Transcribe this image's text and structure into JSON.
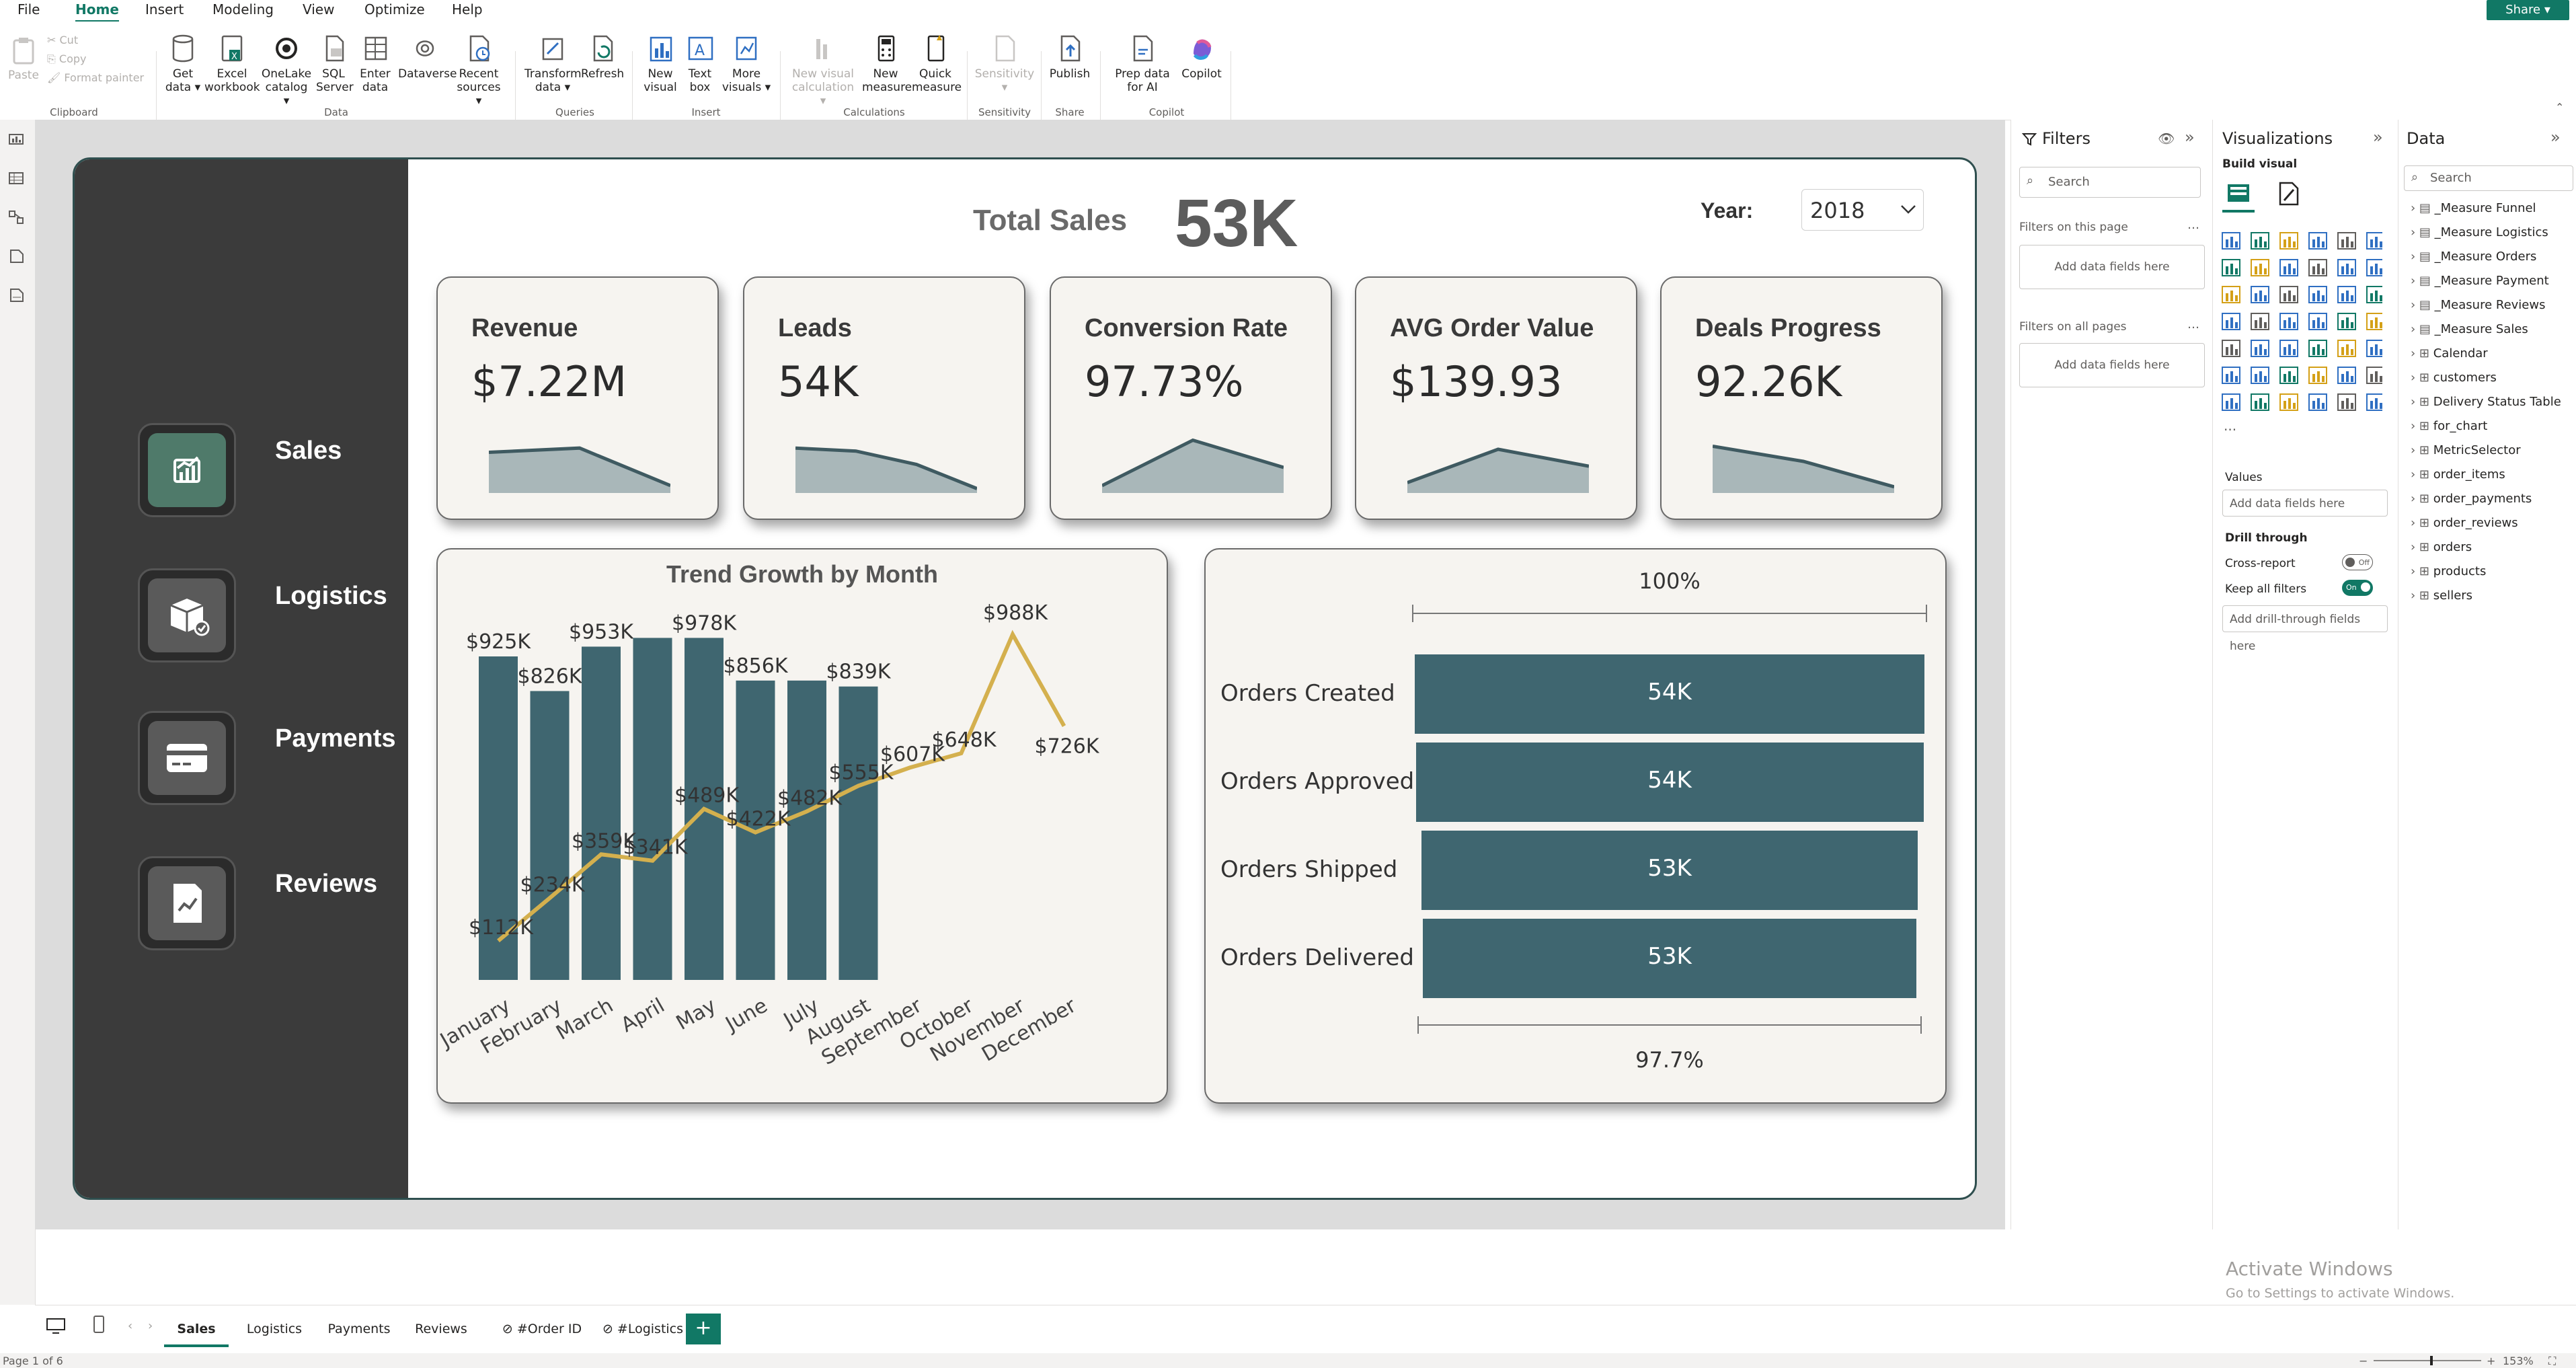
{
  "menu": [
    "File",
    "Home",
    "Insert",
    "Modeling",
    "View",
    "Optimize",
    "Help"
  ],
  "share_label": "Share",
  "ribbon": {
    "clipboard": {
      "paste": "Paste",
      "cut": "Cut",
      "copy": "Copy",
      "format_painter": "Format painter",
      "group": "Clipboard"
    },
    "data": {
      "get_data": "Get data",
      "excel": "Excel workbook",
      "onelake": "OneLake catalog",
      "sql": "SQL Server",
      "enter": "Enter data",
      "dataverse": "Dataverse",
      "recent": "Recent sources",
      "group": "Data"
    },
    "queries": {
      "transform": "Transform data",
      "refresh": "Refresh",
      "group": "Queries"
    },
    "insert": {
      "new_visual": "New visual",
      "text_box": "Text box",
      "more": "More visuals",
      "group": "Insert"
    },
    "calculations": {
      "new_calc": "New visual calculation",
      "new_measure": "New measure",
      "quick": "Quick measure",
      "group": "Calculations"
    },
    "sensitivity": {
      "label": "Sensitivity",
      "group": "Sensitivity"
    },
    "share": {
      "publish": "Publish",
      "group": "Share"
    },
    "copilot": {
      "prep": "Prep data for AI",
      "copilot": "Copilot",
      "group": "Copilot"
    }
  },
  "report": {
    "header": {
      "total_label": "Total Sales",
      "total_value": "53K",
      "year_label": "Year:",
      "year_value": "2018"
    },
    "nav": [
      {
        "label": "Sales"
      },
      {
        "label": "Logistics"
      },
      {
        "label": "Payments"
      },
      {
        "label": "Reviews"
      }
    ],
    "kpis": [
      {
        "title": "Revenue",
        "value": "$7.22M",
        "spark": [
          0.65,
          0.72,
          0.1
        ]
      },
      {
        "title": "Leads",
        "value": "54K",
        "spark": [
          0.72,
          0.67,
          0.45,
          0.05
        ]
      },
      {
        "title": "Conversion Rate",
        "value": "97.73%",
        "spark": [
          0.1,
          0.85,
          0.4
        ]
      },
      {
        "title": "AVG Order Value",
        "value": "$139.93",
        "spark": [
          0.15,
          0.7,
          0.42
        ]
      },
      {
        "title": "Deals Progress",
        "value": "92.26K",
        "spark": [
          0.75,
          0.5,
          0.08
        ]
      }
    ]
  },
  "chart_data": [
    {
      "type": "bar",
      "title": "Trend Growth by Month",
      "categories": [
        "January",
        "February",
        "March",
        "April",
        "May",
        "June",
        "July",
        "August",
        "September",
        "October",
        "November",
        "December"
      ],
      "series": [
        {
          "type": "bar",
          "values": [
            925,
            826,
            953,
            978,
            978,
            856,
            856,
            839,
            null,
            null,
            null,
            null
          ],
          "labels": [
            "$925K",
            "$826K",
            "$953K",
            "",
            "$978K",
            "$856K",
            "",
            "$839K",
            "",
            "",
            "",
            ""
          ]
        },
        {
          "type": "line",
          "values": [
            112,
            234,
            359,
            341,
            489,
            422,
            482,
            555,
            607,
            648,
            988,
            726
          ],
          "labels": [
            "$112K",
            "$234K",
            "$359K",
            "$341K",
            "$489K",
            "$422K",
            "$482K",
            "$555K",
            "$607K",
            "$648K",
            "$988K",
            "$726K"
          ]
        }
      ],
      "colors": {
        "bar": "#3f6670",
        "line": "#d4b04e"
      }
    },
    {
      "type": "funnel",
      "categories": [
        "Orders Created",
        "Orders Approved",
        "Orders Shipped",
        "Orders Delivered"
      ],
      "values": [
        54,
        54,
        53,
        53
      ],
      "value_labels": [
        "54K",
        "54K",
        "53K",
        "53K"
      ],
      "top_label": "100%",
      "bottom_label": "97.7%",
      "colors": {
        "bar": "#3f6670"
      }
    }
  ],
  "filters": {
    "title": "Filters",
    "search": "Search",
    "page_label": "Filters on this page",
    "all_label": "Filters on all pages",
    "add": "Add data fields here"
  },
  "viz": {
    "title": "Visualizations",
    "build": "Build visual",
    "values": "Values",
    "values_add": "Add data fields here",
    "drill": "Drill through",
    "cross": "Cross-report",
    "cross_state": "Off",
    "keep": "Keep all filters",
    "keep_state": "On",
    "drill_add": "Add drill-through fields here"
  },
  "data_pane": {
    "title": "Data",
    "search": "Search",
    "items": [
      "_Measure Funnel",
      "_Measure Logistics",
      "_Measure Orders",
      "_Measure Payment",
      "_Measure Reviews",
      "_Measure Sales",
      "Calendar",
      "customers",
      "Delivery Status Table",
      "for_chart",
      "MetricSelector",
      "order_items",
      "order_payments",
      "order_reviews",
      "orders",
      "products",
      "sellers"
    ]
  },
  "watermark": {
    "title": "Activate Windows",
    "subtitle": "Go to Settings to activate Windows."
  },
  "tabs": [
    "Sales",
    "Logistics",
    "Payments",
    "Reviews",
    "#Order ID",
    "#Logistics"
  ],
  "status": {
    "page": "Page 1 of 6",
    "zoom": "153%"
  }
}
